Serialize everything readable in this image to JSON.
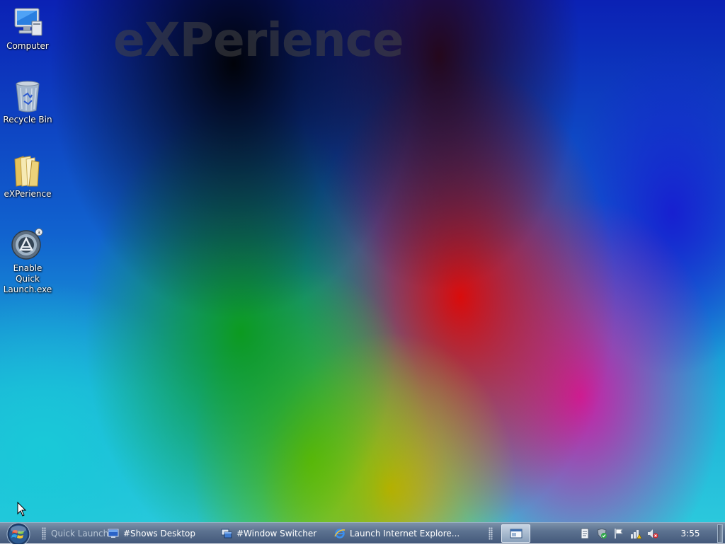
{
  "desktop": {
    "watermark": "eXPerience",
    "icons": [
      {
        "label": "Computer",
        "icon": "computer-icon"
      },
      {
        "label": "Recycle Bin",
        "icon": "recycle-bin-icon"
      },
      {
        "label": "eXPerience",
        "icon": "folder-icon"
      },
      {
        "label": "Enable Quick Launch.exe",
        "icon": "app-launcher-icon"
      }
    ]
  },
  "taskbar": {
    "quick_launch_label": "Quick Launch",
    "items": [
      {
        "label": "#Shows Desktop",
        "icon": "show-desktop-icon"
      },
      {
        "label": "#Window Switcher",
        "icon": "window-switcher-icon"
      },
      {
        "label": "Launch Internet Explore...",
        "icon": "internet-explorer-icon"
      }
    ],
    "tray_icons": [
      "notepad-icon",
      "security-shield-icon",
      "action-center-flag-icon",
      "network-warning-icon",
      "volume-muted-icon"
    ],
    "clock": "3:55"
  },
  "colors": {
    "taskbar_top": "#7c91a9",
    "taskbar_bottom": "#43587a",
    "desktop_text": "#ffffff"
  }
}
